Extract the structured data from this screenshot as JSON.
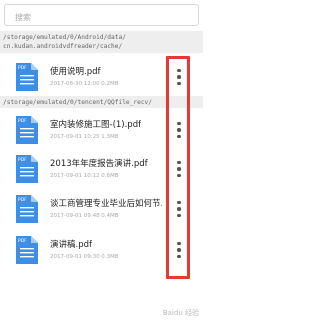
{
  "search": {
    "placeholder": "搜索"
  },
  "folders": [
    {
      "path": "/storage/emulated/0/Android/data/\ncn.kudan.androidvdfreader/cache/",
      "files": [
        {
          "name": "使用说明.pdf",
          "meta": "2017-08-30 12:00  0.2MB"
        }
      ]
    },
    {
      "path": "/storage/emulated/0/tencent/QQfile_recv/",
      "files": [
        {
          "name": "室内装修施工图-(1).pdf",
          "meta": "2017-09-01 10:25  1.3MB"
        },
        {
          "name": "2013年年度报告演讲.pdf",
          "meta": "2017-09-01 10:12  0.6MB"
        },
        {
          "name": "谈工商管理专业毕业后如何节…",
          "meta": "2017-09-01 09:48  0.4MB"
        },
        {
          "name": "演讲稿.pdf",
          "meta": "2017-09-01 09:30  0.3MB"
        }
      ]
    }
  ],
  "icon_label": "PDF",
  "colors": {
    "highlight": "#e53935",
    "pdf_icon": "#3d8ee6",
    "folder_bg": "#eeeeee"
  },
  "watermark": "Baidu 经验"
}
